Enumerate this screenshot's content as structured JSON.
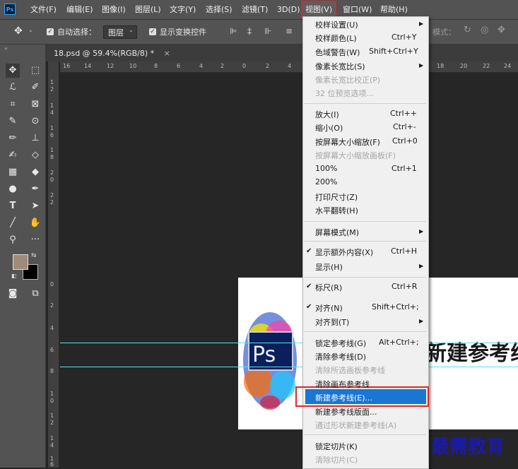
{
  "menubar": {
    "logo": "Ps",
    "items": [
      "文件(F)",
      "编辑(E)",
      "图像(I)",
      "图层(L)",
      "文字(Y)",
      "选择(S)",
      "滤镜(T)",
      "3D(D)",
      "视图(V)",
      "窗口(W)",
      "帮助(H)"
    ]
  },
  "options": {
    "move_icon": "✥",
    "auto_select_label": "自动选择：",
    "auto_select_value": "图层",
    "show_transform_label": "显示变换控件",
    "mode_label": "模式："
  },
  "document": {
    "tab_title": "18.psd @ 59.4%(RGB/8) *",
    "tab_close": "×",
    "canvas_title": "新建参考线"
  },
  "rulers": {
    "h_labels": [
      "16",
      "14",
      "12",
      "10",
      "8",
      "6",
      "4",
      "2",
      "0",
      "2",
      "4",
      "18",
      "20",
      "22",
      "24"
    ],
    "v_labels": [
      "1",
      "2",
      "1",
      "4",
      "1",
      "6",
      "1",
      "8",
      "2",
      "0",
      "2",
      "2",
      "0",
      "2",
      "4",
      "6",
      "8",
      "1",
      "0",
      "1",
      "2",
      "1",
      "4",
      "1",
      "6"
    ]
  },
  "view_menu": {
    "items": [
      {
        "label": "校样设置(U)",
        "shortcut": "",
        "submenu": true,
        "disabled": false,
        "checked": false
      },
      {
        "label": "校样颜色(L)",
        "shortcut": "Ctrl+Y",
        "submenu": false,
        "disabled": false,
        "checked": false
      },
      {
        "label": "色域警告(W)",
        "shortcut": "Shift+Ctrl+Y",
        "submenu": false,
        "disabled": false,
        "checked": false
      },
      {
        "label": "像素长宽比(S)",
        "shortcut": "",
        "submenu": true,
        "disabled": false,
        "checked": false
      },
      {
        "label": "像素长宽比校正(P)",
        "shortcut": "",
        "submenu": false,
        "disabled": true,
        "checked": false
      },
      {
        "label": "32 位预览选项...",
        "shortcut": "",
        "submenu": false,
        "disabled": true,
        "checked": false
      },
      {
        "label": "放大(I)",
        "shortcut": "Ctrl++",
        "submenu": false,
        "disabled": false,
        "checked": false
      },
      {
        "label": "缩小(O)",
        "shortcut": "Ctrl+-",
        "submenu": false,
        "disabled": false,
        "checked": false
      },
      {
        "label": "按屏幕大小缩放(F)",
        "shortcut": "Ctrl+0",
        "submenu": false,
        "disabled": false,
        "checked": false
      },
      {
        "label": "按屏幕大小缩放画板(F)",
        "shortcut": "",
        "submenu": false,
        "disabled": true,
        "checked": false
      },
      {
        "label": "100%",
        "shortcut": "Ctrl+1",
        "submenu": false,
        "disabled": false,
        "checked": false
      },
      {
        "label": "200%",
        "shortcut": "",
        "submenu": false,
        "disabled": false,
        "checked": false
      },
      {
        "label": "打印尺寸(Z)",
        "shortcut": "",
        "submenu": false,
        "disabled": false,
        "checked": false
      },
      {
        "label": "水平翻转(H)",
        "shortcut": "",
        "submenu": false,
        "disabled": false,
        "checked": false
      },
      {
        "label": "屏幕模式(M)",
        "shortcut": "",
        "submenu": true,
        "disabled": false,
        "checked": false
      },
      {
        "label": "显示额外内容(X)",
        "shortcut": "Ctrl+H",
        "submenu": false,
        "disabled": false,
        "checked": true
      },
      {
        "label": "显示(H)",
        "shortcut": "",
        "submenu": true,
        "disabled": false,
        "checked": false
      },
      {
        "label": "标尺(R)",
        "shortcut": "Ctrl+R",
        "submenu": false,
        "disabled": false,
        "checked": true
      },
      {
        "label": "对齐(N)",
        "shortcut": "Shift+Ctrl+;",
        "submenu": false,
        "disabled": false,
        "checked": true
      },
      {
        "label": "对齐到(T)",
        "shortcut": "",
        "submenu": true,
        "disabled": false,
        "checked": false
      },
      {
        "label": "锁定参考线(G)",
        "shortcut": "Alt+Ctrl+;",
        "submenu": false,
        "disabled": false,
        "checked": false
      },
      {
        "label": "清除参考线(D)",
        "shortcut": "",
        "submenu": false,
        "disabled": false,
        "checked": false
      },
      {
        "label": "清除所选画板参考线",
        "shortcut": "",
        "submenu": false,
        "disabled": true,
        "checked": false
      },
      {
        "label": "清除画布参考线",
        "shortcut": "",
        "submenu": false,
        "disabled": false,
        "checked": false
      },
      {
        "label": "新建参考线(E)...",
        "shortcut": "",
        "submenu": false,
        "disabled": false,
        "checked": false,
        "highlighted": true
      },
      {
        "label": "新建参考线版面...",
        "shortcut": "",
        "submenu": false,
        "disabled": false,
        "checked": false
      },
      {
        "label": "通过形状新建参考线(A)",
        "shortcut": "",
        "submenu": false,
        "disabled": true,
        "checked": false
      },
      {
        "label": "锁定切片(K)",
        "shortcut": "",
        "submenu": false,
        "disabled": false,
        "checked": false
      },
      {
        "label": "清除切片(C)",
        "shortcut": "",
        "submenu": false,
        "disabled": true,
        "checked": false
      }
    ]
  },
  "watermark": "最需教育",
  "colors": {
    "foreground": "#a08a79",
    "background": "#000000",
    "highlight": "#1976d2",
    "annotation": "#e0262b",
    "guide": "#4fe6e6"
  }
}
